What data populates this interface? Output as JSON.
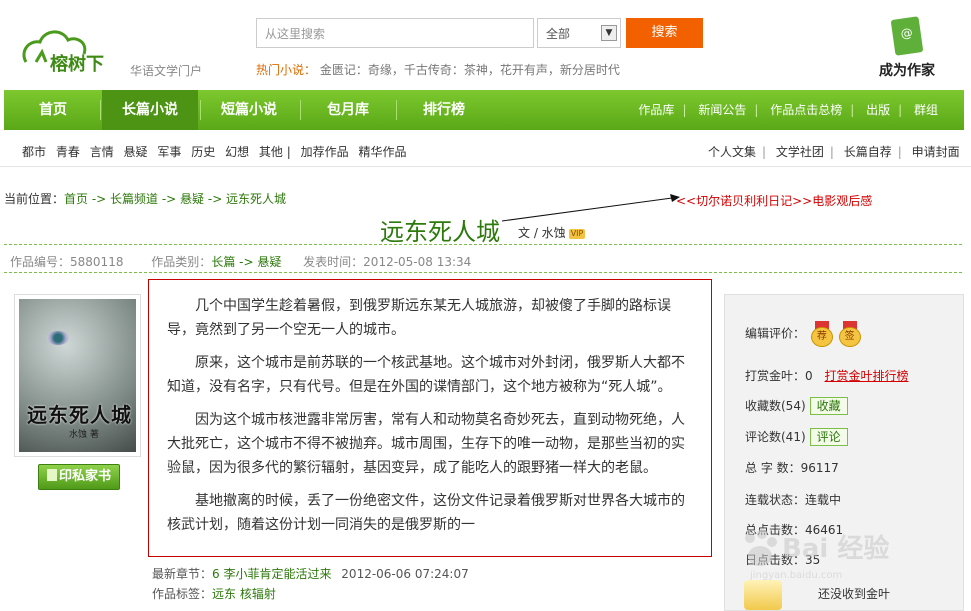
{
  "header": {
    "brand": "榕树下",
    "tagline": "华语文学门户",
    "search_placeholder": "从这里搜索",
    "search_scope": "全部",
    "search_button": "搜索",
    "hot_label": "热门小说：",
    "hot_items": "金匮记：奇缘，千古传奇：茶神，花开有声，新分居时代",
    "author_cta": "成为作家"
  },
  "nav": {
    "items": [
      "首页",
      "长篇小说",
      "短篇小说",
      "包月库",
      "排行榜"
    ],
    "right": [
      "作品库",
      "新闻公告",
      "作品点击总榜",
      "出版",
      "群组"
    ]
  },
  "subnav": {
    "items": [
      "都市",
      "青春",
      "言情",
      "悬疑",
      "军事",
      "历史",
      "幻想",
      "其他 |",
      "加荐作品",
      "精华作品"
    ],
    "right": [
      "个人文集",
      "文学社团",
      "长篇自荐",
      "申请封面"
    ]
  },
  "breadcrumb": {
    "label": "当前位置：",
    "path": "首页 -> 长篇频道 -> 悬疑 -> 远东死人城"
  },
  "related_link": "<<切尔诺贝利利日记>>电影观后感",
  "work": {
    "title": "远东死人城",
    "byline": "文 / 水蚀",
    "vip": "VIP",
    "id_label": "作品编号：",
    "id": "5880118",
    "cat_label": "作品类别：",
    "category": "长篇 -> 悬疑",
    "date_label": "发表时间：",
    "published": "2012-05-08 13:34",
    "cover_title": "远东死人城",
    "cover_sub": "水蚀 著",
    "print_button": "印私家书",
    "synopsis": [
      "几个中国学生趁着暑假，到俄罗斯远东某无人城旅游，却被傻了手脚的路标误导，竟然到了另一个空无一人的城市。",
      "原来，这个城市是前苏联的一个核武基地。这个城市对外封闭，俄罗斯人大都不知道，没有名字，只有代号。但是在外国的谍情部门，这个地方被称为“死人城”。",
      "因为这个城市核泄露非常厉害，常有人和动物莫名奇妙死去，直到动物死绝，人大批死亡，这个城市不得不被抛弃。城市周围，生存下的唯一动物，是那些当初的实验鼠，因为很多代的繁衍辐射，基因变异，成了能吃人的跟野猪一样大的老鼠。",
      "基地撤离的时候，丢了一份绝密文件，这份文件记录着俄罗斯对世界各大城市的核武计划，随着这份计划一同消失的是俄罗斯的一"
    ],
    "latest_label": "最新章节：",
    "latest_chapter": "6 李小菲肯定能活过来",
    "latest_time": "2012-06-06 07:24:07",
    "tags_label": "作品标签：",
    "tags": "远东 核辐射"
  },
  "panel": {
    "editor_label": "编辑评价：",
    "medals": [
      "荐",
      "签"
    ],
    "tip_label": "打赏金叶：",
    "tip_value": "0",
    "tip_rank": "打赏金叶排行榜",
    "fav_label": "收藏数(54)",
    "fav_button": "收藏",
    "comment_label": "评论数(41)",
    "comment_button": "评论",
    "words_label": "总 字 数：",
    "words": "96117",
    "status_label": "连载状态：",
    "status": "连载中",
    "clicks_label": "总点击数：",
    "clicks": "46461",
    "daily_label": "日点击数：",
    "daily": "35",
    "no_gold": "还没收到金叶"
  },
  "watermark": {
    "text": "Bai 经验",
    "sub": "jingyan.baidu.com"
  }
}
